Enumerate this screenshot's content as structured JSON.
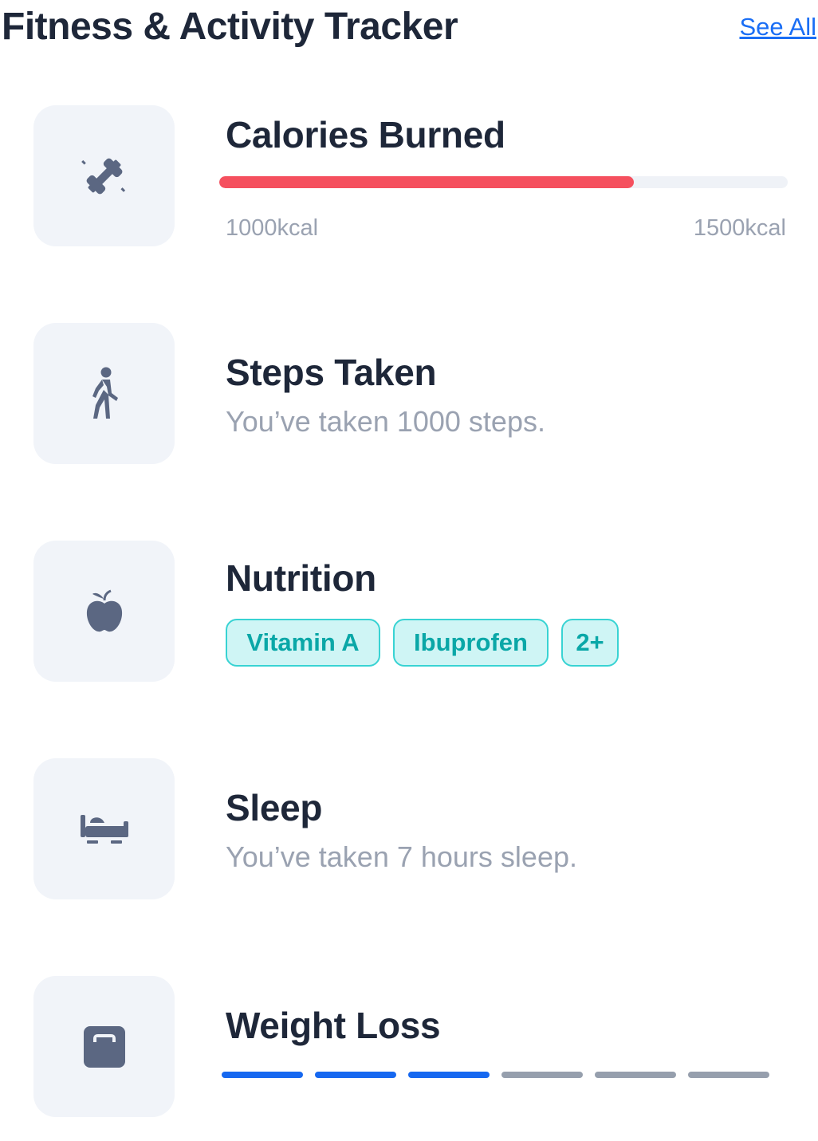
{
  "header": {
    "title": "Fitness & Activity Tracker",
    "see_all": "See All"
  },
  "calories": {
    "title": "Calories Burned",
    "min_label": "1000kcal",
    "max_label": "1500kcal",
    "progress_fraction": 0.73,
    "bar_color": "#f5505e",
    "icon": "dumbbell-icon"
  },
  "steps": {
    "title": "Steps Taken",
    "subtitle": "You’ve taken 1000 steps.",
    "icon": "walking-person-icon"
  },
  "nutrition": {
    "title": "Nutrition",
    "tags": [
      "Vitamin A",
      "Ibuprofen"
    ],
    "more": "2+",
    "icon": "apple-icon"
  },
  "sleep": {
    "title": "Sleep",
    "subtitle": "You’ve taken 7 hours  sleep.",
    "icon": "bed-icon"
  },
  "weight": {
    "title": "Weight Loss",
    "segments_total": 6,
    "segments_done": 3,
    "done_color": "#1668f0",
    "icon": "scale-icon"
  }
}
